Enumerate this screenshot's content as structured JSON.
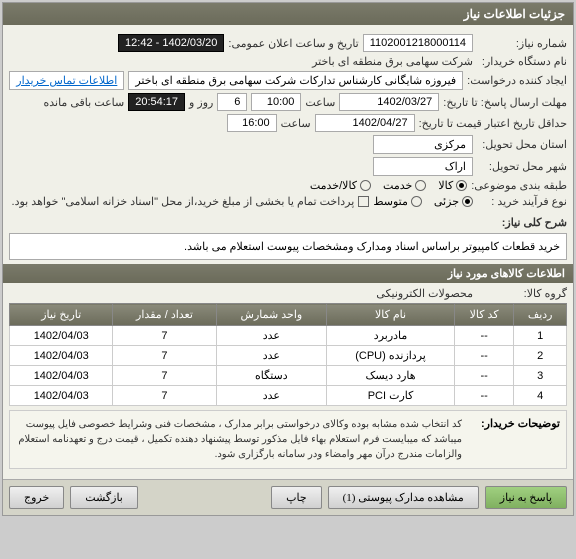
{
  "titlebar": "جزئیات اطلاعات نیاز",
  "fields": {
    "need_no_label": "شماره نیاز:",
    "need_no": "1102001218000114",
    "public_dt_label": "تاریخ و ساعت اعلان عمومی:",
    "public_dt": "1402/03/20 - 12:42",
    "buyer_label": "نام دستگاه خریدار:",
    "buyer": "شرکت سهامی برق منطقه ای باختر",
    "creator_label": "ایجاد کننده درخواست:",
    "creator": "فیروزه شایگانی کارشناس تدارکات شرکت سهامی برق منطقه ای باختر",
    "contact_link": "اطلاعات تماس خریدار",
    "deadline_label": "مهلت ارسال پاسخ: تا تاریخ:",
    "deadline_date": "1402/03/27",
    "time_label": "ساعت",
    "deadline_time": "10:00",
    "days": "6",
    "days_label": "روز و",
    "remaining": "20:54:17",
    "remaining_label": "ساعت باقی مانده",
    "validity_label": "حداقل تاریخ اعتبار قیمت تا تاریخ:",
    "validity_date": "1402/04/27",
    "validity_time": "16:00",
    "province_label": "استان محل تحویل:",
    "province": "مرکزی",
    "city_label": "شهر محل تحویل:",
    "city": "اراک",
    "category_label": "طبقه بندی موضوعی:",
    "opt_goods": "کالا",
    "opt_service": "خدمت",
    "opt_both": "کالا/خدمت",
    "process_label": "نوع فرآیند خرید :",
    "opt_low": "جزئی",
    "opt_mid": "متوسط",
    "payment_note": "پرداخت تمام یا بخشی از مبلغ خرید،از محل \"اسناد خزانه اسلامی\" خواهد بود."
  },
  "desc": {
    "label": "شرح کلی نیاز:",
    "text": "خرید قطعات کامپیوتر  براساس اسناد ومدارک ومشخصات پیوست استعلام می باشد."
  },
  "items_section": "اطلاعات کالاهای مورد نیاز",
  "group_label": "گروه کالا:",
  "group_value": "محصولات الکترونیکی",
  "table": {
    "headers": [
      "ردیف",
      "کد کالا",
      "نام کالا",
      "واحد شمارش",
      "تعداد / مقدار",
      "تاریخ نیاز"
    ],
    "rows": [
      [
        "1",
        "--",
        "مادربرد",
        "عدد",
        "7",
        "1402/04/03"
      ],
      [
        "2",
        "--",
        "پردازنده (CPU)",
        "عدد",
        "7",
        "1402/04/03"
      ],
      [
        "3",
        "--",
        "هارد دیسک",
        "دستگاه",
        "7",
        "1402/04/03"
      ],
      [
        "4",
        "--",
        "کارت PCI",
        "عدد",
        "7",
        "1402/04/03"
      ]
    ]
  },
  "note": {
    "label": "توضیحات خریدار:",
    "text": "کد انتخاب شده مشابه بوده وکالای درخواستی برابر مدارک ، مشخصات فنی وشرایط خصوصی فایل پیوست میباشد که میبایست فرم استعلام بهاء فایل مذکور توسط پیشنهاد دهنده تکمیل ، قیمت درج و تعهدنامه استعلام والزامات  مندرج درآن مهر وامضاء ودر سامانه بارگزاری شود."
  },
  "buttons": {
    "reply": "پاسخ به نیاز",
    "attachments": "مشاهده مدارک پیوستی (1)",
    "print": "چاپ",
    "back": "بازگشت",
    "exit": "خروج"
  }
}
